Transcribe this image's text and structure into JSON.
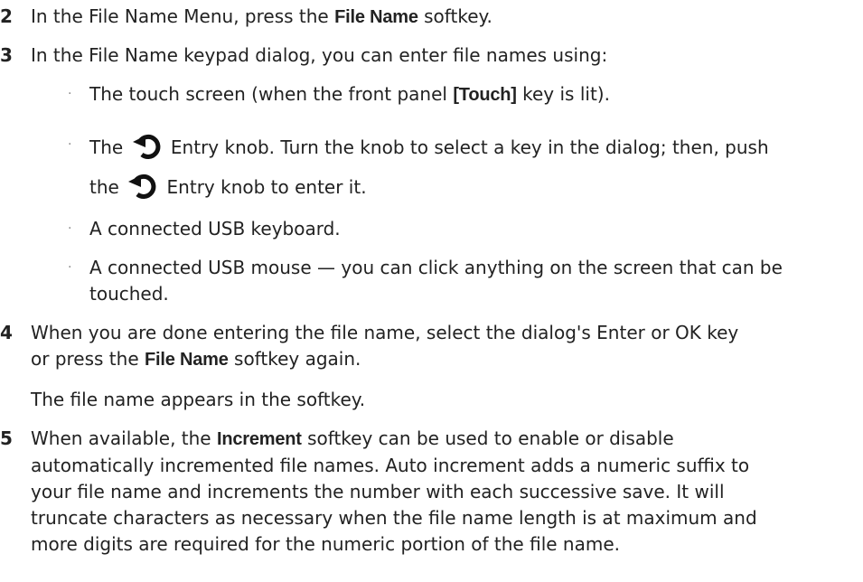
{
  "steps": [
    {
      "num": "2",
      "before": "In the File Name Menu, press the ",
      "bold": "File Name",
      "after": " softkey."
    },
    {
      "num": "3",
      "text": "In the File Name keypad dialog, you can enter file names using:"
    },
    {
      "num": "4",
      "line1": "When you are done entering the file name, select the dialog's Enter or OK key",
      "line2_before": "or press the ",
      "bold": "File Name",
      "line2_after": " softkey again.",
      "note": "The file name appears in the softkey."
    },
    {
      "num": "5",
      "line1_before": "When available, the ",
      "bold": "Increment",
      "line1_after": " softkey can be used to enable or disable",
      "rest": [
        "automatically incremented file names. Auto increment adds a numeric suffix to",
        "your file name and increments the number with each successive save. It will",
        "truncate characters as necessary when the file name length is at maximum and",
        "more digits are required for the numeric portion of the file name."
      ]
    }
  ],
  "bullets": {
    "marker": "·",
    "touch": {
      "before": "The touch screen (when the front panel ",
      "bold": "[Touch]",
      "after": " key is lit)."
    },
    "knob": {
      "line1_before": "The ",
      "line1_after": " Entry knob. Turn the knob to select a key in the dialog; then, push",
      "line2_before": "the ",
      "line2_after": " Entry knob to enter it."
    },
    "keyboard": "A connected USB keyboard.",
    "mouse": {
      "line1": "A connected USB mouse — you can click anything on the screen that can be",
      "line2": "touched."
    }
  },
  "icons": {
    "entry_knob": "entry-knob-icon"
  }
}
